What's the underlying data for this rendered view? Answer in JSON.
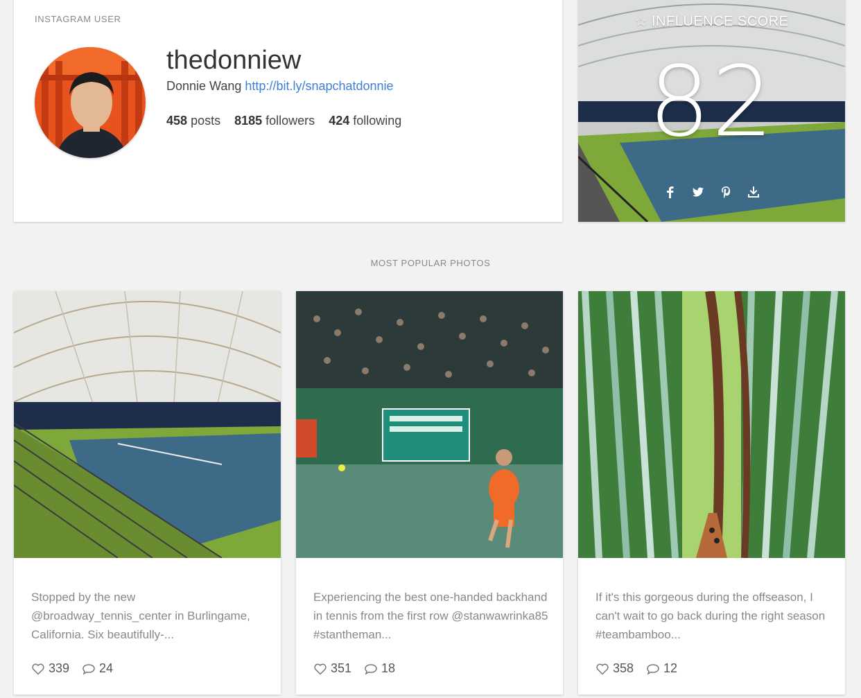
{
  "profile": {
    "label": "INSTAGRAM USER",
    "username": "thedonniew",
    "full_name": "Donnie Wang",
    "link": "http://bit.ly/snapchatdonnie",
    "posts_count": "458",
    "posts_label": "posts",
    "followers_count": "8185",
    "followers_label": "followers",
    "following_count": "424",
    "following_label": "following"
  },
  "influence": {
    "title": "INFLUENCE SCORE",
    "score": "82",
    "share_icons": [
      "facebook-icon",
      "twitter-icon",
      "pinterest-icon",
      "download-icon"
    ]
  },
  "section_title": "MOST POPULAR PHOTOS",
  "photos": [
    {
      "caption": "Stopped by the new @broadway_tennis_center in Burlingame, California. Six beautifully-...",
      "likes": "339",
      "comments": "24"
    },
    {
      "caption": "Experiencing the best one-handed backhand in tennis from the first row @stanwawrinka85 #stantheman...",
      "likes": "351",
      "comments": "18"
    },
    {
      "caption": "If it's this gorgeous during the offseason, I can't wait to go back during the right season #teambamboo...",
      "likes": "358",
      "comments": "12"
    }
  ],
  "colors": {
    "link": "#3f7fd6",
    "background": "#f2f2f2",
    "court_blue": "#3d6a86",
    "court_green": "#7fa83a"
  }
}
